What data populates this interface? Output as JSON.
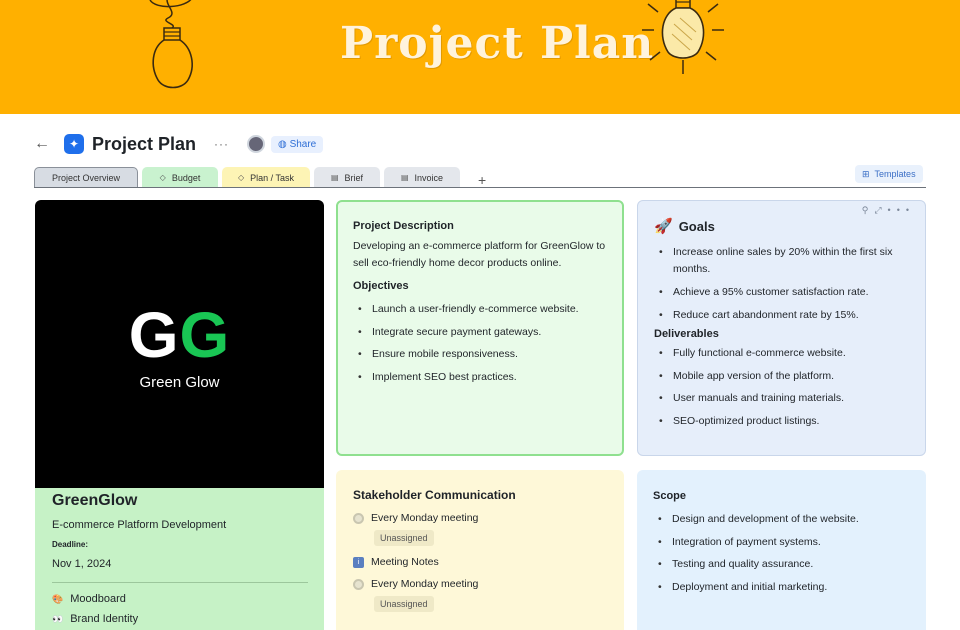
{
  "banner": {
    "title": "Project Plan"
  },
  "header": {
    "title": "Project Plan",
    "more": "···",
    "share_label": "Share"
  },
  "tabs": [
    {
      "label": "Project Overview",
      "icon": "none",
      "color": "#d7dce3"
    },
    {
      "label": "Budget",
      "icon": "diamond-icon",
      "color": "#c9f2cf"
    },
    {
      "label": "Plan / Task",
      "icon": "diamond-icon",
      "color": "#fdf4b5"
    },
    {
      "label": "Brief",
      "icon": "document-icon",
      "color": "#e4e7ec"
    },
    {
      "label": "Invoice",
      "icon": "document-icon",
      "color": "#e4e7ec"
    }
  ],
  "templates_label": "Templates",
  "brand": {
    "logo_letters": [
      "G",
      "G"
    ],
    "logo_text": "Green Glow",
    "name": "GreenGlow",
    "subtitle": "E-commerce Platform Development",
    "deadline_label": "Deadline:",
    "deadline_value": "Nov 1, 2024",
    "links": [
      {
        "icon": "palette-icon",
        "label": "Moodboard"
      },
      {
        "icon": "eyes-icon",
        "label": "Brand Identity"
      }
    ],
    "accent": "#19c654"
  },
  "description": {
    "heading": "Project Description",
    "text": "Developing an e-commerce platform for GreenGlow to sell eco-friendly home decor products online.",
    "objectives_heading": "Objectives",
    "objectives": [
      "Launch a user-friendly e-commerce website.",
      "Integrate secure payment gateways.",
      "Ensure mobile responsiveness.",
      "Implement SEO best practices."
    ]
  },
  "goals": {
    "title": "Goals",
    "items": [
      "Increase online sales by 20% within the first six months.",
      "Achieve a 95% customer satisfaction rate.",
      "Reduce cart abandonment rate by 15%."
    ],
    "deliverables_heading": "Deliverables",
    "deliverables": [
      "Fully functional e-commerce website.",
      "Mobile app version of the platform.",
      "User manuals and training materials.",
      "SEO-optimized product listings."
    ]
  },
  "stakeholder": {
    "title": "Stakeholder Communication",
    "rows": [
      {
        "label": "Every Monday meeting",
        "badge": "Unassigned"
      },
      {
        "label": "Meeting Notes"
      },
      {
        "label": "Every Monday meeting",
        "badge": "Unassigned"
      }
    ]
  },
  "scope": {
    "heading": "Scope",
    "items": [
      "Design and development of the website.",
      "Integration of payment systems.",
      "Testing and quality assurance.",
      "Deployment and initial marketing."
    ]
  }
}
